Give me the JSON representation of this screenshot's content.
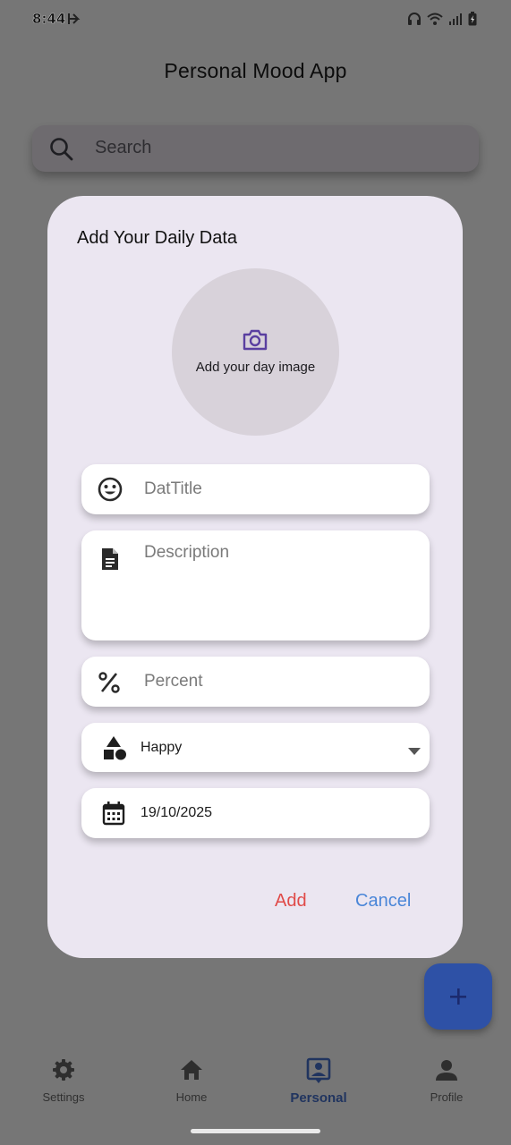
{
  "status_bar": {
    "time": "8:44",
    "left_icons": [
      "app-notification-icon"
    ],
    "right_icons": [
      "headphones-icon",
      "wifi-icon",
      "signal-icon",
      "battery-charging-icon"
    ]
  },
  "app_bar": {
    "title": "Personal Mood App"
  },
  "search": {
    "placeholder": "Search",
    "icon": "search-icon"
  },
  "dialog": {
    "title": "Add Your Daily Data",
    "image_picker": {
      "label": "Add your day image",
      "icon": "camera-icon"
    },
    "fields": {
      "title": {
        "placeholder": "DatTitle",
        "icon": "smiley-icon"
      },
      "description": {
        "placeholder": "Description",
        "icon": "document-icon"
      },
      "percent": {
        "placeholder": "Percent",
        "icon": "percent-icon"
      },
      "mood": {
        "value": "Happy",
        "icon": "shapes-icon"
      },
      "date": {
        "value": "19/10/2025",
        "icon": "calendar-icon"
      }
    },
    "buttons": {
      "add": "Add",
      "cancel": "Cancel"
    }
  },
  "fab": {
    "icon": "plus-icon"
  },
  "bottom_nav": {
    "items": [
      {
        "label": "Settings",
        "icon": "gear-icon"
      },
      {
        "label": "Home",
        "icon": "home-icon"
      },
      {
        "label": "Personal",
        "icon": "personal-badge-icon",
        "selected": true
      },
      {
        "label": "Profile",
        "icon": "person-icon"
      }
    ]
  },
  "colors": {
    "scrim": "#767676",
    "dialog_bg": "#ebe6f1",
    "add_button": "#e04a48",
    "cancel_button": "#4a86d8",
    "fab": "#2e51a6",
    "selected_nav": "#20345f"
  }
}
